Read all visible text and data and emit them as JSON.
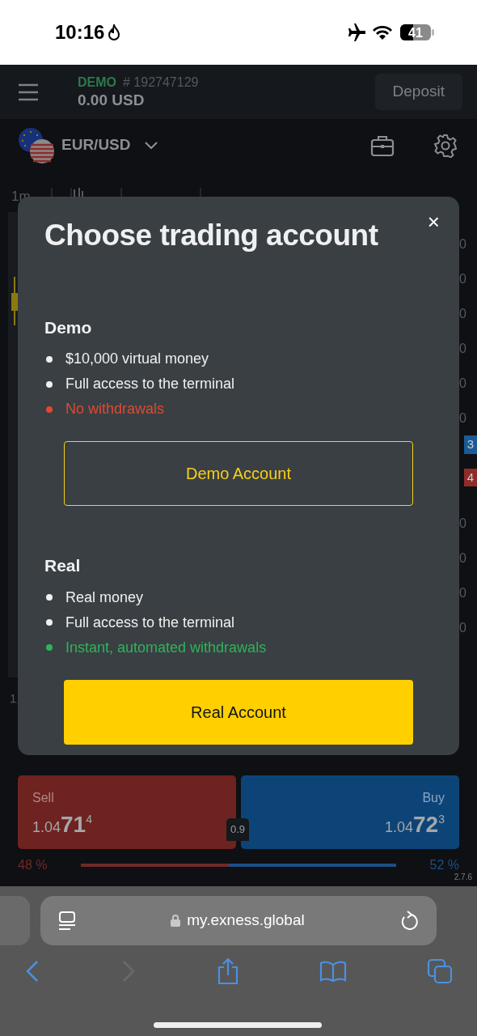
{
  "status_bar": {
    "time": "10:16",
    "battery": "41"
  },
  "header": {
    "mode": "DEMO",
    "account": "# 192747129",
    "balance": "0.00 USD",
    "deposit": "Deposit"
  },
  "symbol": {
    "name": "EUR/USD"
  },
  "chart": {
    "timeframe": "1m",
    "axis_labels": [
      "0",
      "0",
      "0",
      "0",
      "0",
      "0"
    ],
    "price_tags": [
      {
        "text": "3",
        "color": "#1a5a96"
      },
      {
        "text": "4",
        "color": "#8e2c2a"
      }
    ],
    "axis_labels_lower": [
      "0",
      "0",
      "0",
      "0"
    ],
    "side_label": "1"
  },
  "modal": {
    "title": "Choose trading account",
    "close": "×",
    "sections": [
      {
        "heading": "Demo",
        "features": [
          {
            "text": "$10,000 virtual money",
            "kind": "neutral"
          },
          {
            "text": "Full access to the terminal",
            "kind": "neutral"
          },
          {
            "text": "No withdrawals",
            "kind": "negative"
          }
        ],
        "button": {
          "label": "Demo Account",
          "kind": "outline"
        }
      },
      {
        "heading": "Real",
        "features": [
          {
            "text": "Real money",
            "kind": "neutral"
          },
          {
            "text": "Full access to the terminal",
            "kind": "neutral"
          },
          {
            "text": "Instant, automated withdrawals",
            "kind": "positive"
          }
        ],
        "button": {
          "label": "Real Account",
          "kind": "solid"
        }
      }
    ]
  },
  "trade": {
    "sell": {
      "label": "Sell",
      "price": "1.04",
      "pips": "71",
      "fraction": "4"
    },
    "buy": {
      "label": "Buy",
      "price": "1.04",
      "pips": "72",
      "fraction": "3"
    },
    "spread": "0.9",
    "sell_percent": "48 %",
    "buy_percent": "52 %",
    "sentiment": {
      "level": 0.47
    },
    "version": "2.7.6"
  },
  "browser": {
    "url": "my.exness.global"
  }
}
